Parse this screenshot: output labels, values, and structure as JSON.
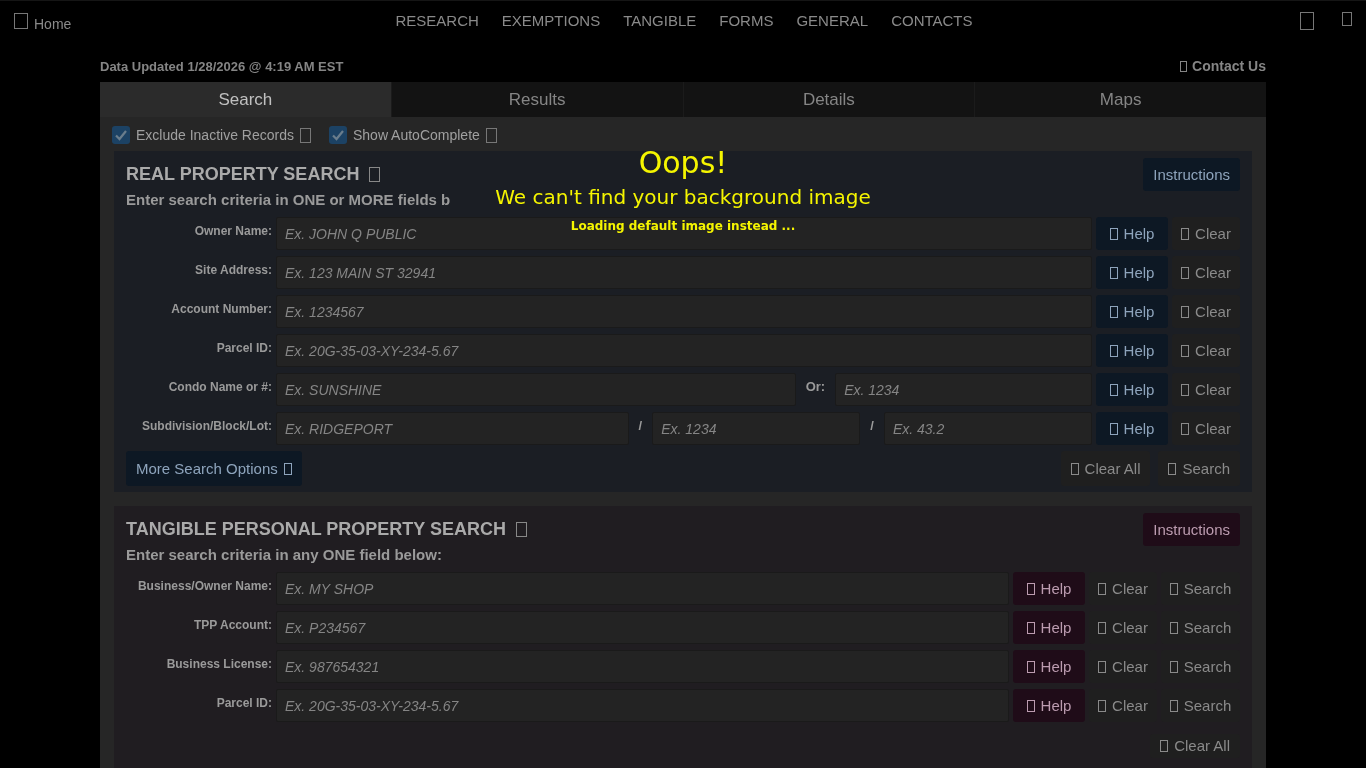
{
  "header": {
    "home": "Home",
    "nav": [
      "RESEARCH",
      "EXEMPTIONS",
      "TANGIBLE",
      "FORMS",
      "GENERAL",
      "CONTACTS"
    ]
  },
  "data_updated": "Data Updated 1/28/2026 @ 4:19 AM EST",
  "contact": "Contact Us",
  "tabs": [
    {
      "label": "Search",
      "selected": true
    },
    {
      "label": "Results",
      "selected": false
    },
    {
      "label": "Details",
      "selected": false
    },
    {
      "label": "Maps",
      "selected": false
    }
  ],
  "options": [
    {
      "label": "Exclude Inactive Records",
      "checked": true
    },
    {
      "label": "Show AutoComplete",
      "checked": true
    }
  ],
  "sections": [
    {
      "kind": "real",
      "title": "REAL PROPERTY SEARCH",
      "instructions": "Instructions",
      "subtitle": "Enter search criteria in ONE or MORE fields b",
      "rows": [
        {
          "label": "Owner Name:",
          "fields": [
            {
              "placeholder": "Ex. JOHN Q PUBLIC"
            }
          ],
          "buttons": [
            {
              "kind": "help",
              "label": "Help"
            },
            {
              "kind": "clear",
              "label": "Clear"
            }
          ]
        },
        {
          "label": "Site Address:",
          "fields": [
            {
              "placeholder": "Ex. 123 MAIN ST 32941"
            }
          ],
          "buttons": [
            {
              "kind": "help",
              "label": "Help"
            },
            {
              "kind": "clear",
              "label": "Clear"
            }
          ]
        },
        {
          "label": "Account Number:",
          "fields": [
            {
              "placeholder": "Ex. 1234567"
            }
          ],
          "buttons": [
            {
              "kind": "help",
              "label": "Help"
            },
            {
              "kind": "clear",
              "label": "Clear"
            }
          ]
        },
        {
          "label": "Parcel ID:",
          "fields": [
            {
              "placeholder": "Ex. 20G-35-03-XY-234-5.67"
            }
          ],
          "buttons": [
            {
              "kind": "help",
              "label": "Help"
            },
            {
              "kind": "clear",
              "label": "Clear"
            }
          ]
        },
        {
          "label": "Condo Name or #:",
          "fields": [
            {
              "placeholder": "Ex. SUNSHINE"
            },
            {
              "prefix": "Or:",
              "placeholder": "Ex. 1234"
            }
          ],
          "buttons": [
            {
              "kind": "help",
              "label": "Help"
            },
            {
              "kind": "clear",
              "label": "Clear"
            }
          ]
        },
        {
          "label": "Subdivision/Block/Lot:",
          "fields": [
            {
              "placeholder": "Ex. RIDGEPORT"
            },
            {
              "prefix": "/",
              "placeholder": "Ex. 1234"
            },
            {
              "prefix": "/",
              "placeholder": "Ex. 43.2"
            }
          ],
          "buttons": [
            {
              "kind": "help",
              "label": "Help"
            },
            {
              "kind": "clear",
              "label": "Clear"
            }
          ]
        }
      ],
      "actions": [
        {
          "kind": "more",
          "label": "More Search Options"
        },
        {
          "kind": "clear_all",
          "label": "Clear All"
        },
        {
          "kind": "search",
          "label": "Search"
        }
      ]
    },
    {
      "kind": "tpp",
      "title": "TANGIBLE PERSONAL PROPERTY SEARCH",
      "instructions": "Instructions",
      "subtitle": "Enter search criteria in any ONE field below:",
      "rows": [
        {
          "label": "Business/Owner Name:",
          "fields": [
            {
              "placeholder": "Ex. MY SHOP"
            }
          ],
          "buttons": [
            {
              "kind": "help",
              "label": "Help"
            },
            {
              "kind": "clear",
              "label": "Clear"
            },
            {
              "kind": "search",
              "label": "Search"
            }
          ]
        },
        {
          "label": "TPP Account:",
          "fields": [
            {
              "placeholder": "Ex. P234567"
            }
          ],
          "buttons": [
            {
              "kind": "help",
              "label": "Help"
            },
            {
              "kind": "clear",
              "label": "Clear"
            },
            {
              "kind": "search",
              "label": "Search"
            }
          ]
        },
        {
          "label": "Business License:",
          "fields": [
            {
              "placeholder": "Ex. 987654321"
            }
          ],
          "buttons": [
            {
              "kind": "help",
              "label": "Help"
            },
            {
              "kind": "clear",
              "label": "Clear"
            },
            {
              "kind": "search",
              "label": "Search"
            }
          ]
        },
        {
          "label": "Parcel ID:",
          "fields": [
            {
              "placeholder": "Ex. 20G-35-03-XY-234-5.67"
            }
          ],
          "buttons": [
            {
              "kind": "help",
              "label": "Help"
            },
            {
              "kind": "clear",
              "label": "Clear"
            },
            {
              "kind": "search",
              "label": "Search"
            }
          ]
        }
      ],
      "actions": [
        {
          "kind": "clear_all",
          "label": "Clear All"
        }
      ]
    }
  ],
  "overlay": {
    "title": "Oops!",
    "message": "We can't find your background image",
    "note": "Loading default image instead ..."
  }
}
